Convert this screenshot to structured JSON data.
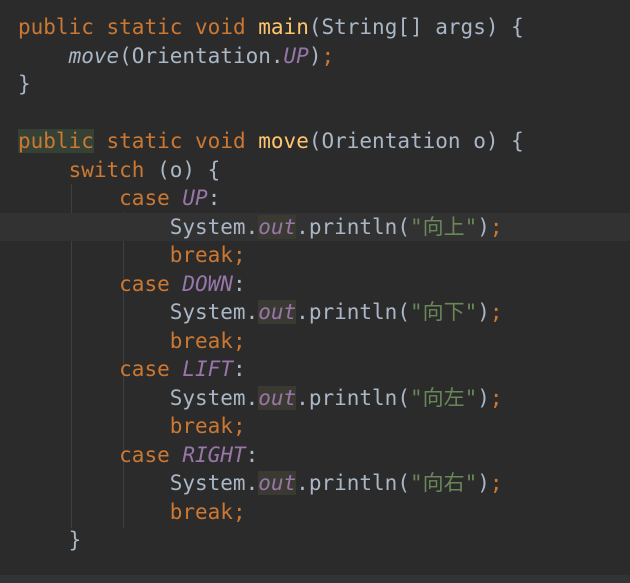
{
  "lines": [
    {
      "indent": "",
      "tokens": [
        {
          "t": "public",
          "c": "kw"
        },
        {
          "t": " "
        },
        {
          "t": "static",
          "c": "kw"
        },
        {
          "t": " "
        },
        {
          "t": "void",
          "c": "kw"
        },
        {
          "t": " "
        },
        {
          "t": "main",
          "c": "fn"
        },
        {
          "t": "(String[] args) {"
        }
      ]
    },
    {
      "indent": "    ",
      "tokens": [
        {
          "t": "move",
          "c": "italic-call"
        },
        {
          "t": "(Orientation."
        },
        {
          "t": "UP",
          "c": "const"
        },
        {
          "t": ")"
        },
        {
          "t": ";",
          "c": "punct"
        }
      ]
    },
    {
      "indent": "",
      "tokens": [
        {
          "t": "}"
        }
      ]
    },
    {
      "indent": "",
      "tokens": []
    },
    {
      "indent": "",
      "tokens": [
        {
          "t": "public",
          "c": "kw hl-public"
        },
        {
          "t": " "
        },
        {
          "t": "static",
          "c": "kw"
        },
        {
          "t": " "
        },
        {
          "t": "void",
          "c": "kw"
        },
        {
          "t": " "
        },
        {
          "t": "move",
          "c": "fn"
        },
        {
          "t": "(Orientation o) {"
        }
      ]
    },
    {
      "indent": "    ",
      "tokens": [
        {
          "t": "switch",
          "c": "kw"
        },
        {
          "t": " (o) {"
        }
      ]
    },
    {
      "indent": "        ",
      "tokens": [
        {
          "t": "case",
          "c": "kw"
        },
        {
          "t": " "
        },
        {
          "t": "UP",
          "c": "const"
        },
        {
          "t": ":"
        }
      ]
    },
    {
      "indent": "            ",
      "current": true,
      "tokens": [
        {
          "t": "System."
        },
        {
          "t": "out",
          "c": "const hl-word"
        },
        {
          "t": ".println("
        },
        {
          "t": "\"向上\"",
          "c": "str"
        },
        {
          "t": ")"
        },
        {
          "t": ";",
          "c": "punct"
        }
      ]
    },
    {
      "indent": "            ",
      "tokens": [
        {
          "t": "break",
          "c": "kw"
        },
        {
          "t": ";",
          "c": "punct"
        }
      ]
    },
    {
      "indent": "        ",
      "tokens": [
        {
          "t": "case",
          "c": "kw"
        },
        {
          "t": " "
        },
        {
          "t": "DOWN",
          "c": "const"
        },
        {
          "t": ":"
        }
      ]
    },
    {
      "indent": "            ",
      "tokens": [
        {
          "t": "System."
        },
        {
          "t": "out",
          "c": "const hl-word"
        },
        {
          "t": ".println("
        },
        {
          "t": "\"向下\"",
          "c": "str"
        },
        {
          "t": ")"
        },
        {
          "t": ";",
          "c": "punct"
        }
      ]
    },
    {
      "indent": "            ",
      "tokens": [
        {
          "t": "break",
          "c": "kw"
        },
        {
          "t": ";",
          "c": "punct"
        }
      ]
    },
    {
      "indent": "        ",
      "tokens": [
        {
          "t": "case",
          "c": "kw"
        },
        {
          "t": " "
        },
        {
          "t": "LIFT",
          "c": "const"
        },
        {
          "t": ":"
        }
      ]
    },
    {
      "indent": "            ",
      "tokens": [
        {
          "t": "System."
        },
        {
          "t": "out",
          "c": "const hl-word"
        },
        {
          "t": ".println("
        },
        {
          "t": "\"向左\"",
          "c": "str"
        },
        {
          "t": ")"
        },
        {
          "t": ";",
          "c": "punct"
        }
      ]
    },
    {
      "indent": "            ",
      "tokens": [
        {
          "t": "break",
          "c": "kw"
        },
        {
          "t": ";",
          "c": "punct"
        }
      ]
    },
    {
      "indent": "        ",
      "tokens": [
        {
          "t": "case",
          "c": "kw"
        },
        {
          "t": " "
        },
        {
          "t": "RIGHT",
          "c": "const"
        },
        {
          "t": ":"
        }
      ]
    },
    {
      "indent": "            ",
      "tokens": [
        {
          "t": "System."
        },
        {
          "t": "out",
          "c": "const hl-word"
        },
        {
          "t": ".println("
        },
        {
          "t": "\"向右\"",
          "c": "str"
        },
        {
          "t": ")"
        },
        {
          "t": ";",
          "c": "punct"
        }
      ]
    },
    {
      "indent": "            ",
      "tokens": [
        {
          "t": "break",
          "c": "kw"
        },
        {
          "t": ";",
          "c": "punct"
        }
      ]
    },
    {
      "indent": "    ",
      "tokens": [
        {
          "t": "}"
        }
      ]
    }
  ]
}
